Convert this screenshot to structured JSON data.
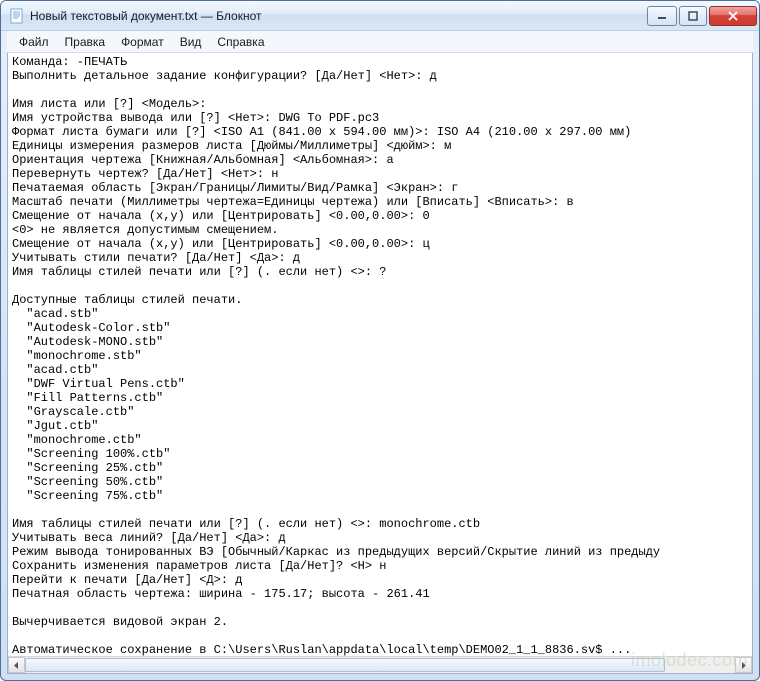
{
  "title": "Новый текстовый документ.txt — Блокнот",
  "menu": {
    "file": "Файл",
    "edit": "Правка",
    "format": "Формат",
    "view": "Вид",
    "help": "Справка"
  },
  "body": "Команда: -ПЕЧАТЬ\nВыполнить детальное задание конфигурации? [Да/Нет] <Нет>: д\n\nИмя листа или [?] <Модель>:\nИмя устройства вывода или [?] <Нет>: DWG To PDF.pc3\nФормат листа бумаги или [?] <ISO A1 (841.00 x 594.00 мм)>: ISO A4 (210.00 x 297.00 мм)\nЕдиницы измерения размеров листа [Дюймы/Миллиметры] <дюйм>: м\nОриентация чертежа [Книжная/Альбомная] <Альбомная>: а\nПеревернуть чертеж? [Да/Нет] <Нет>: н\nПечатаемая область [Экран/Границы/Лимиты/Вид/Рамка] <Экран>: г\nМасштаб печати (Миллиметры чертежа=Единицы чертежа) или [Вписать] <Вписать>: в\nСмещение от начала (x,y) или [Центрировать] <0.00,0.00>: 0\n<0> не является допустимым смещением.\nСмещение от начала (x,y) или [Центрировать] <0.00,0.00>: ц\nУчитывать стили печати? [Да/Нет] <Да>: д\nИмя таблицы стилей печати или [?] (. если нет) <>: ?\n\nДоступные таблицы стилей печати.\n  \"acad.stb\"\n  \"Autodesk-Color.stb\"\n  \"Autodesk-MONO.stb\"\n  \"monochrome.stb\"\n  \"acad.ctb\"\n  \"DWF Virtual Pens.ctb\"\n  \"Fill Patterns.ctb\"\n  \"Grayscale.ctb\"\n  \"Jgut.ctb\"\n  \"monochrome.ctb\"\n  \"Screening 100%.ctb\"\n  \"Screening 25%.ctb\"\n  \"Screening 50%.ctb\"\n  \"Screening 75%.ctb\"\n\nИмя таблицы стилей печати или [?] (. если нет) <>: monochrome.ctb\nУчитывать веса линий? [Да/Нет] <Да>: д\nРежим вывода тонированных ВЭ [Обычный/Каркас из предыдущих версий/Скрытие линий из предыду\nСохранить изменения параметров листа [Да/Нет]? <Н> н\nПерейти к печати [Да/Нет] <Д>: д\nПечатная область чертежа: ширина - 175.17; высота - 261.41\n\nВычерчивается видовой экран 2.\n\nАвтоматическое сохранение в C:\\Users\\Ruslan\\appdata\\local\\temp\\DEMO02_1_1_8836.sv$ ...\n",
  "watermark": "imolodec.com"
}
